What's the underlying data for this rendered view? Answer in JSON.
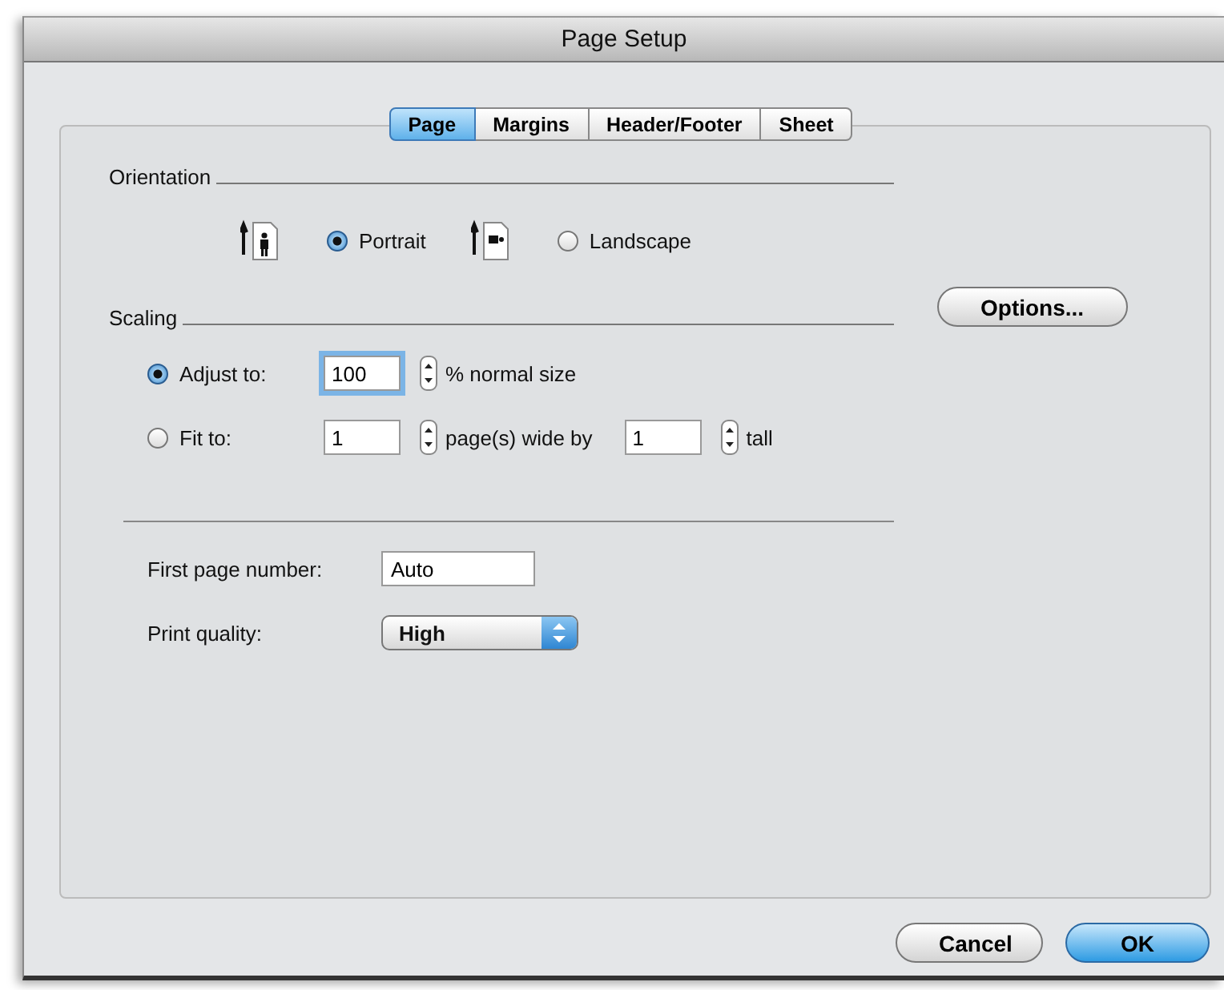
{
  "window": {
    "title": "Page Setup"
  },
  "tabs": [
    {
      "label": "Page",
      "selected": true
    },
    {
      "label": "Margins",
      "selected": false
    },
    {
      "label": "Header/Footer",
      "selected": false
    },
    {
      "label": "Sheet",
      "selected": false
    }
  ],
  "orientation": {
    "label": "Orientation",
    "options": [
      {
        "kind": "portrait",
        "label": "Portrait",
        "selected": true
      },
      {
        "kind": "landscape",
        "label": "Landscape",
        "selected": false
      }
    ]
  },
  "options_button": "Options...",
  "scaling": {
    "label": "Scaling",
    "adjust": {
      "label": "Adjust to:",
      "selected": true,
      "value": "100",
      "suffix": "% normal size"
    },
    "fit": {
      "label": "Fit to:",
      "selected": false,
      "wide_value": "1",
      "wide_suffix": "page(s) wide by",
      "tall_value": "1",
      "tall_suffix": "tall"
    }
  },
  "first_page_number": {
    "label": "First page number:",
    "value": "Auto"
  },
  "print_quality": {
    "label": "Print quality:",
    "value": "High"
  },
  "buttons": [
    {
      "label": "Cancel",
      "default": false
    },
    {
      "label": "OK",
      "default": true
    }
  ]
}
